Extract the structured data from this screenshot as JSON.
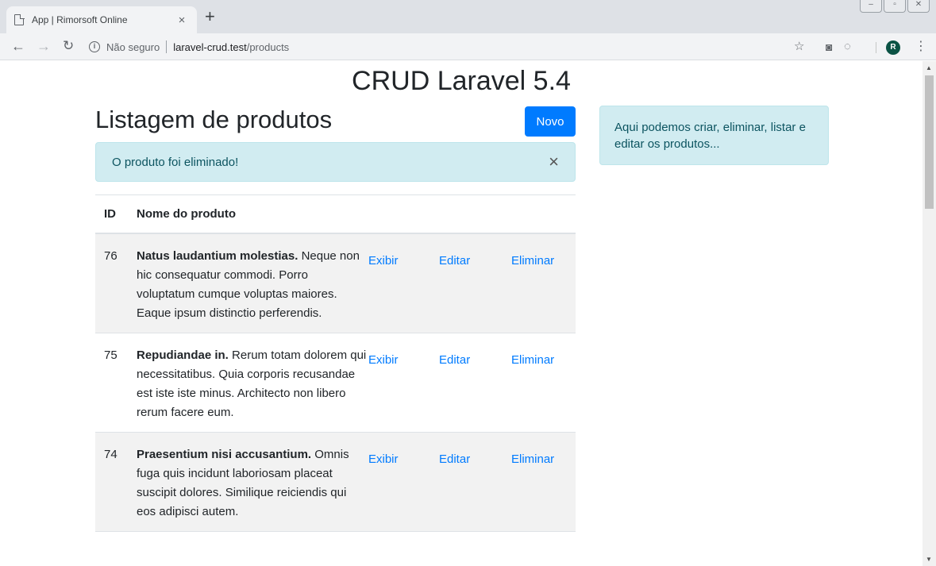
{
  "browser": {
    "tab_title": "App | Rimorsoft Online",
    "tab_close": "×",
    "new_tab": "+",
    "security_text": "Não seguro",
    "url_host": "laravel-crud.test",
    "url_path": "/products"
  },
  "page": {
    "title": "CRUD Laravel 5.4",
    "list_title": "Listagem de produtos",
    "new_button": "Novo",
    "alert_text": "O produto foi eliminado!",
    "alert_close": "×",
    "side_note": "Aqui podemos criar, eliminar, listar e editar os produtos..."
  },
  "table": {
    "headers": [
      "ID",
      "Nome do produto"
    ],
    "rows": [
      {
        "id": "76",
        "name": "Natus laudantium molestias.",
        "description": "Neque non hic consequatur commodi. Porro voluptatum cumque voluptas maiores. Eaque ipsum distinctio perferendis."
      },
      {
        "id": "75",
        "name": "Repudiandae in.",
        "description": "Rerum totam dolorem qui necessitatibus. Quia corporis recusandae est iste iste minus. Architecto non libero rerum facere eum."
      },
      {
        "id": "74",
        "name": "Praesentium nisi accusantium.",
        "description": "Omnis fuga quis incidunt laboriosam placeat suscipit dolores. Similique reiciendis qui eos adipisci autem."
      }
    ],
    "actions": [
      "Exibir",
      "Editar",
      "Eliminar"
    ]
  },
  "icons": {
    "back": "back-arrow-icon",
    "forward": "forward-arrow-icon",
    "reload": "reload-icon",
    "bookmark": "star-icon",
    "camera": "camera-icon",
    "extension": "extension-icon",
    "menu": "kebab-menu-icon",
    "profile_initial": "R"
  },
  "colors": {
    "primary": "#007bff",
    "alert_bg": "#d1ecf1",
    "alert_text": "#0c5460"
  }
}
